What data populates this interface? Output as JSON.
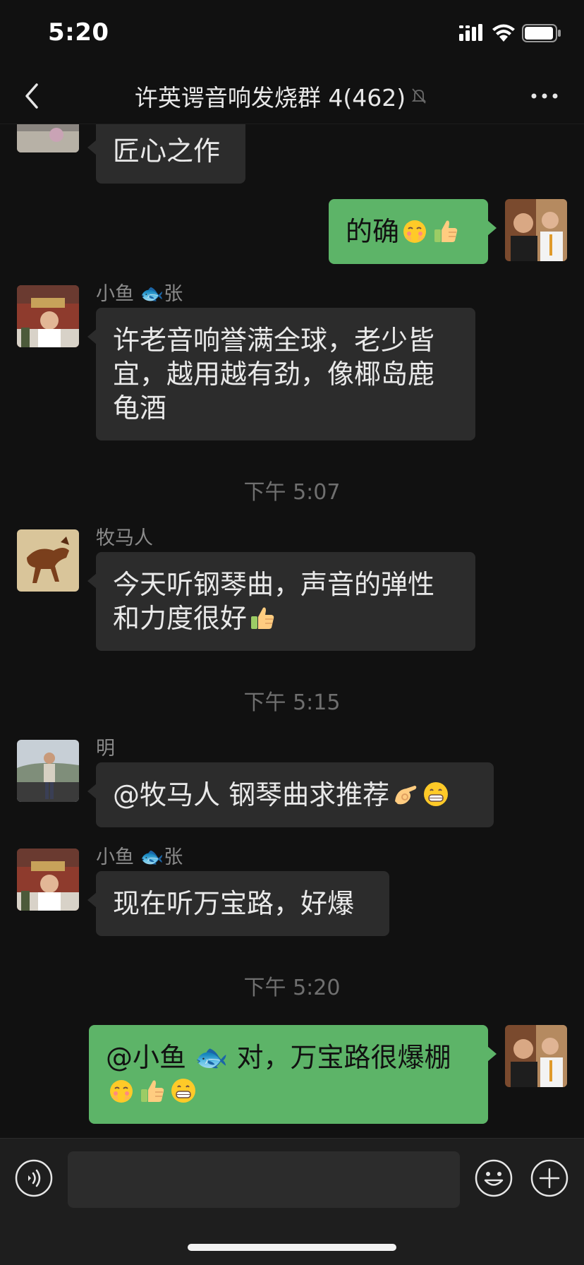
{
  "status_bar": {
    "time": "5:20"
  },
  "nav": {
    "title": "许英谔音响发烧群 4(462)"
  },
  "messages": [
    {
      "sender": "",
      "text": "匠心之作"
    },
    {
      "sender": "",
      "text": "的确"
    },
    {
      "sender": "小鱼 🐟张",
      "text": "许老音响誉满全球，老少皆宜，越用越有劲，像椰岛鹿龟酒"
    },
    {
      "sender": "牧马人",
      "text": "今天听钢琴曲，声音的弹性和力度很好"
    },
    {
      "sender": "明",
      "text": "@牧马人 钢琴曲求推荐"
    },
    {
      "sender": "小鱼 🐟张",
      "text": "现在听万宝路，好爆"
    },
    {
      "sender": "",
      "text": "@小鱼 🐟 对，万宝路很爆棚"
    }
  ],
  "timestamps": [
    "下午 5:07",
    "下午 5:15",
    "下午 5:20"
  ],
  "input": {
    "value": "",
    "placeholder": ""
  },
  "icons": {
    "back": "chevron-left-icon",
    "mute": "bell-slash-icon",
    "more": "ellipsis-icon",
    "voice": "voice-icon",
    "emoji": "smiley-icon",
    "add": "plus-icon"
  },
  "colors": {
    "background": "#111111",
    "incoming_bubble": "#2c2c2c",
    "outgoing_bubble": "#5db468",
    "input_bar": "#1e1e1e"
  }
}
